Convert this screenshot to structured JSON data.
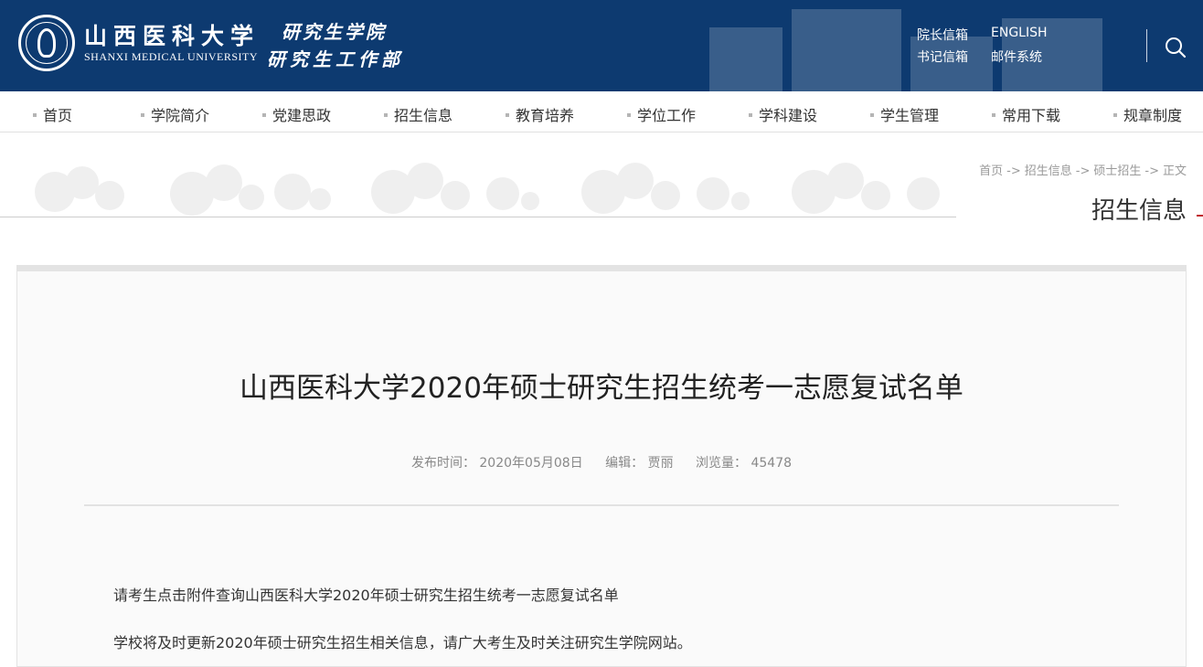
{
  "header": {
    "logo_cn": "山西医科大学",
    "logo_en": "SHANXI MEDICAL UNIVERSITY",
    "dept_line1": "研究生学院",
    "dept_line2": "研究生工作部",
    "links": {
      "president_mailbox": "院长信箱",
      "english": "ENGLISH",
      "secretary_mailbox": "书记信箱",
      "mail_system": "邮件系统"
    },
    "search_icon": "search-icon",
    "brand_color": "#0d3a70"
  },
  "nav": {
    "items": [
      "首页",
      "学院简介",
      "党建思政",
      "招生信息",
      "教育培养",
      "学位工作",
      "学科建设",
      "学生管理",
      "常用下载",
      "规章制度"
    ]
  },
  "breadcrumb": {
    "items": [
      "首页",
      "招生信息",
      "硕士招生",
      "正文"
    ],
    "separator": "->"
  },
  "section_title": "招生信息",
  "article": {
    "title": "山西医科大学2020年硕士研究生招生统考一志愿复试名单",
    "meta": {
      "publish_time": "发布时间： 2020年05月08日",
      "editor": "编辑： 贾丽",
      "views": "浏览量： 45478"
    },
    "paragraphs": [
      "请考生点击附件查询山西医科大学2020年硕士研究生招生统考一志愿复试名单",
      "学校将及时更新2020年硕士研究生招生相关信息，请广大考生及时关注研究生学院网站。"
    ]
  }
}
